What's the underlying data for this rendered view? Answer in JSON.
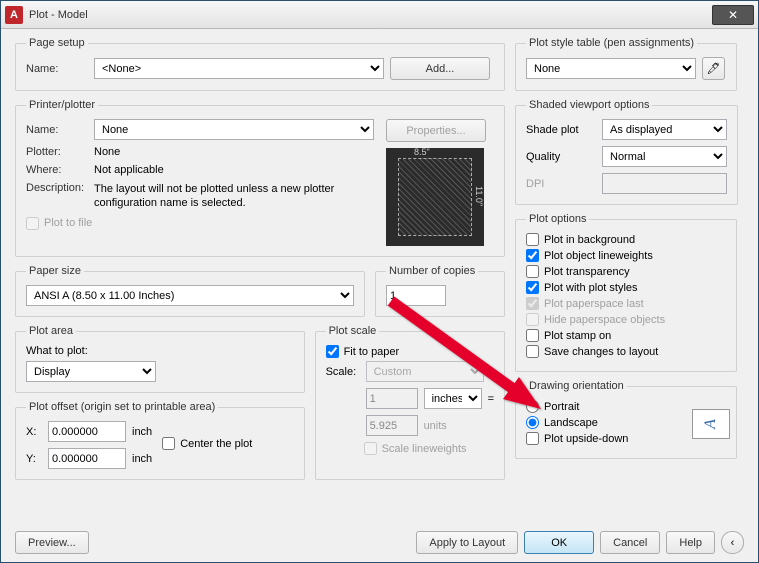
{
  "window": {
    "title": "Plot - Model"
  },
  "pagesetup": {
    "legend": "Page setup",
    "name_label": "Name:",
    "name_value": "<None>",
    "add_label": "Add..."
  },
  "printer": {
    "legend": "Printer/plotter",
    "name_label": "Name:",
    "name_value": "None",
    "properties_label": "Properties...",
    "plotter_label": "Plotter:",
    "plotter_value": "None",
    "where_label": "Where:",
    "where_value": "Not applicable",
    "desc_label": "Description:",
    "desc_value": "The layout will not be plotted unless a new plotter configuration name is selected.",
    "plot_to_file": "Plot to file",
    "preview_w": "8.5\"",
    "preview_h": "11.0\""
  },
  "papersize": {
    "legend": "Paper size",
    "value": "ANSI A (8.50 x 11.00 Inches)"
  },
  "copies": {
    "legend": "Number of copies",
    "value": "1"
  },
  "plotarea": {
    "legend": "Plot area",
    "what_label": "What to plot:",
    "what_value": "Display"
  },
  "plotscale": {
    "legend": "Plot scale",
    "fit": "Fit to paper",
    "scale_label": "Scale:",
    "scale_value": "Custom",
    "num": "1",
    "units": "inches",
    "denom": "5.925",
    "denom_units": "units",
    "lineweights": "Scale lineweights",
    "eq": "="
  },
  "offset": {
    "legend": "Plot offset (origin set to printable area)",
    "x_label": "X:",
    "x_value": "0.000000",
    "y_label": "Y:",
    "y_value": "0.000000",
    "unit": "inch",
    "center": "Center the plot"
  },
  "styletable": {
    "legend": "Plot style table (pen assignments)",
    "value": "None"
  },
  "shaded": {
    "legend": "Shaded viewport options",
    "shade_label": "Shade plot",
    "shade_value": "As displayed",
    "quality_label": "Quality",
    "quality_value": "Normal",
    "dpi_label": "DPI",
    "dpi_value": ""
  },
  "options": {
    "legend": "Plot options",
    "bg": "Plot in background",
    "lw": "Plot object lineweights",
    "trans": "Plot transparency",
    "styles": "Plot with plot styles",
    "pspace": "Plot paperspace last",
    "hide": "Hide paperspace objects",
    "stamp": "Plot stamp on",
    "save": "Save changes to layout"
  },
  "orient": {
    "legend": "Drawing orientation",
    "portrait": "Portrait",
    "landscape": "Landscape",
    "upside": "Plot upside-down",
    "glyph": "A"
  },
  "footer": {
    "preview": "Preview...",
    "apply": "Apply to Layout",
    "ok": "OK",
    "cancel": "Cancel",
    "help": "Help"
  }
}
